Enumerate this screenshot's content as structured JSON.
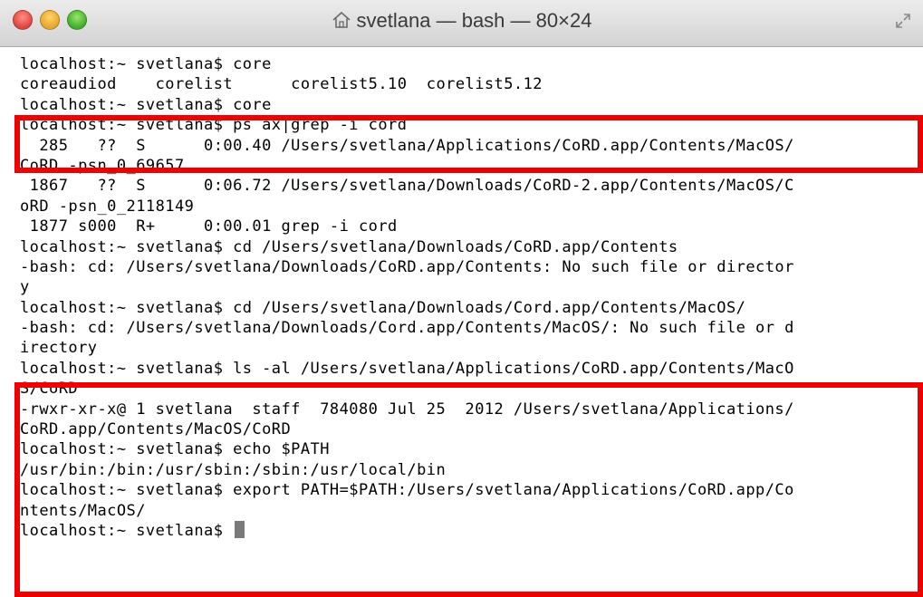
{
  "window": {
    "title": "svetlana — bash — 80×24",
    "title_icon": "home-icon"
  },
  "terminal": {
    "lines": [
      "localhost:~ svetlana$ core",
      "coreaudiod    corelist      corelist5.10  corelist5.12",
      "localhost:~ svetlana$ core",
      "localhost:~ svetlana$ ps ax|grep -i cord",
      "  285   ??  S      0:00.40 /Users/svetlana/Applications/CoRD.app/Contents/MacOS/",
      "CoRD -psn_0_69657",
      " 1867   ??  S      0:06.72 /Users/svetlana/Downloads/CoRD-2.app/Contents/MacOS/C",
      "oRD -psn_0_2118149",
      " 1877 s000  R+     0:00.01 grep -i cord",
      "localhost:~ svetlana$ cd /Users/svetlana/Downloads/CoRD.app/Contents",
      "-bash: cd: /Users/svetlana/Downloads/CoRD.app/Contents: No such file or director",
      "y",
      "localhost:~ svetlana$ cd /Users/svetlana/Downloads/Cord.app/Contents/MacOS/",
      "-bash: cd: /Users/svetlana/Downloads/Cord.app/Contents/MacOS/: No such file or d",
      "irectory",
      "localhost:~ svetlana$ ls -al /Users/svetlana/Applications/CoRD.app/Contents/MacO",
      "S/CoRD",
      "-rwxr-xr-x@ 1 svetlana  staff  784080 Jul 25  2012 /Users/svetlana/Applications/",
      "CoRD.app/Contents/MacOS/CoRD",
      "localhost:~ svetlana$ echo $PATH",
      "/usr/bin:/bin:/usr/sbin:/sbin:/usr/local/bin",
      "localhost:~ svetlana$ export PATH=$PATH:/Users/svetlana/Applications/CoRD.app/Co",
      "ntents/MacOS/",
      "localhost:~ svetlana$ "
    ]
  },
  "colors": {
    "highlight_box": "#ee0000",
    "cursor": "#7a7a7a",
    "text": "#000000",
    "background": "#ffffff"
  }
}
